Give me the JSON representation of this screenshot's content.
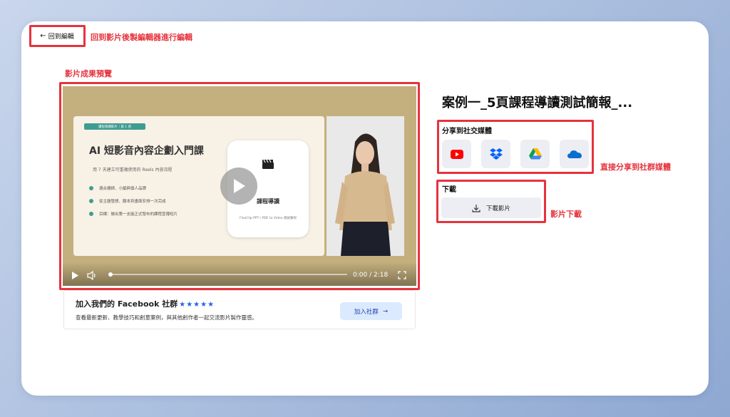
{
  "back_button": {
    "label": "回到編輯",
    "icon": "arrow-left-icon"
  },
  "annotations": {
    "back": "回到影片後製編輯器進行編輯",
    "preview": "影片成果預覽",
    "share": "直接分享到社群媒體",
    "download": "影片下載"
  },
  "video": {
    "slide": {
      "tag": "課程導讀影片｜第 1 頁",
      "title": "AI 短影音內容企劃入門課",
      "subtitle": "用 7 天建立可重複使用的 Reels 內容流程",
      "bullets": [
        "適合講師、小編與個人品牌",
        "從主題發想、腳本到畫面安排一次完成",
        "目標：做出第一支能正式發布的課程宣傳短片"
      ],
      "card_title": "課程導讀",
      "card_subtitle": "FlexClip PPT / PDF to Video 測試素材"
    },
    "current_time": "0:00",
    "duration": "2:18",
    "time_display": "0:00 / 2:18",
    "progress": 0
  },
  "facebook": {
    "title": "加入我們的 Facebook 社群",
    "stars": "★★★★★",
    "rating": 5,
    "description": "查看最新更新、教學技巧和創意案例，與其他創作者一起交流影片製作靈感。",
    "join_label": "加入社群"
  },
  "project": {
    "title": "案例一_5頁課程導讀測試簡報_..."
  },
  "share": {
    "label": "分享到社交媒體",
    "services": [
      "youtube-icon",
      "dropbox-icon",
      "google-drive-icon",
      "onedrive-icon"
    ]
  },
  "download": {
    "label": "下載",
    "button_label": "下載影片"
  },
  "colors": {
    "annotation": "#e5333d",
    "video_background": "#c4b07e",
    "slide_accent": "#3f9c93",
    "star": "#2563eb",
    "join_button_bg": "#dbeafe"
  }
}
